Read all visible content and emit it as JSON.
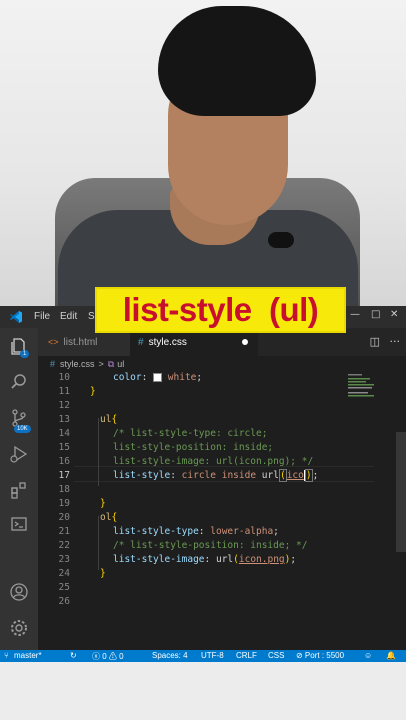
{
  "banner": {
    "title": "list-style  (ul)"
  },
  "titlebar": {
    "menu": [
      "File",
      "Edit",
      "Se"
    ],
    "controls": {
      "minimize": "—",
      "maximize": "□",
      "close": "✕"
    }
  },
  "tabs": [
    {
      "label": "list.html",
      "icon": "html-file-icon",
      "active": false
    },
    {
      "label": "style.css",
      "icon": "css-file-icon",
      "active": true,
      "modified": true
    }
  ],
  "breadcrumb": {
    "file": "style.css",
    "sep": ">",
    "symbol": "ul"
  },
  "activity": {
    "explorer_badge": "1",
    "scm_badge": "10K"
  },
  "code_lines": [
    {
      "n": "10",
      "text": "color: white;"
    },
    {
      "n": "11",
      "text": "}"
    },
    {
      "n": "12",
      "text": ""
    },
    {
      "n": "13",
      "text": "ul{"
    },
    {
      "n": "14",
      "text": "/* list-style-type: circle;"
    },
    {
      "n": "15",
      "text": "list-style-position: inside;"
    },
    {
      "n": "16",
      "text": "list-style-image: url(icon.png); */"
    },
    {
      "n": "17",
      "text": "list-style: circle inside url(ico);"
    },
    {
      "n": "18",
      "text": ""
    },
    {
      "n": "19",
      "text": "}"
    },
    {
      "n": "20",
      "text": "ol{"
    },
    {
      "n": "21",
      "text": "list-style-type: lower-alpha;"
    },
    {
      "n": "22",
      "text": "/* list-style-position: inside; */"
    },
    {
      "n": "23",
      "text": "list-style-image: url(icon.png);"
    },
    {
      "n": "24",
      "text": "}"
    },
    {
      "n": "25",
      "text": ""
    },
    {
      "n": "26",
      "text": ""
    }
  ],
  "statusbar": {
    "branch": "master*",
    "problems": "ⓧ 0 ⚠ 0",
    "spaces": "Spaces: 4",
    "encoding": "UTF-8",
    "eol": "CRLF",
    "language": "CSS",
    "port": "⊘ Port : 5500"
  },
  "colors": {
    "banner_bg": "#f7ea0a",
    "banner_text": "#c8102e",
    "status_bar": "#007acc",
    "editor_bg": "#1e1e1e"
  }
}
